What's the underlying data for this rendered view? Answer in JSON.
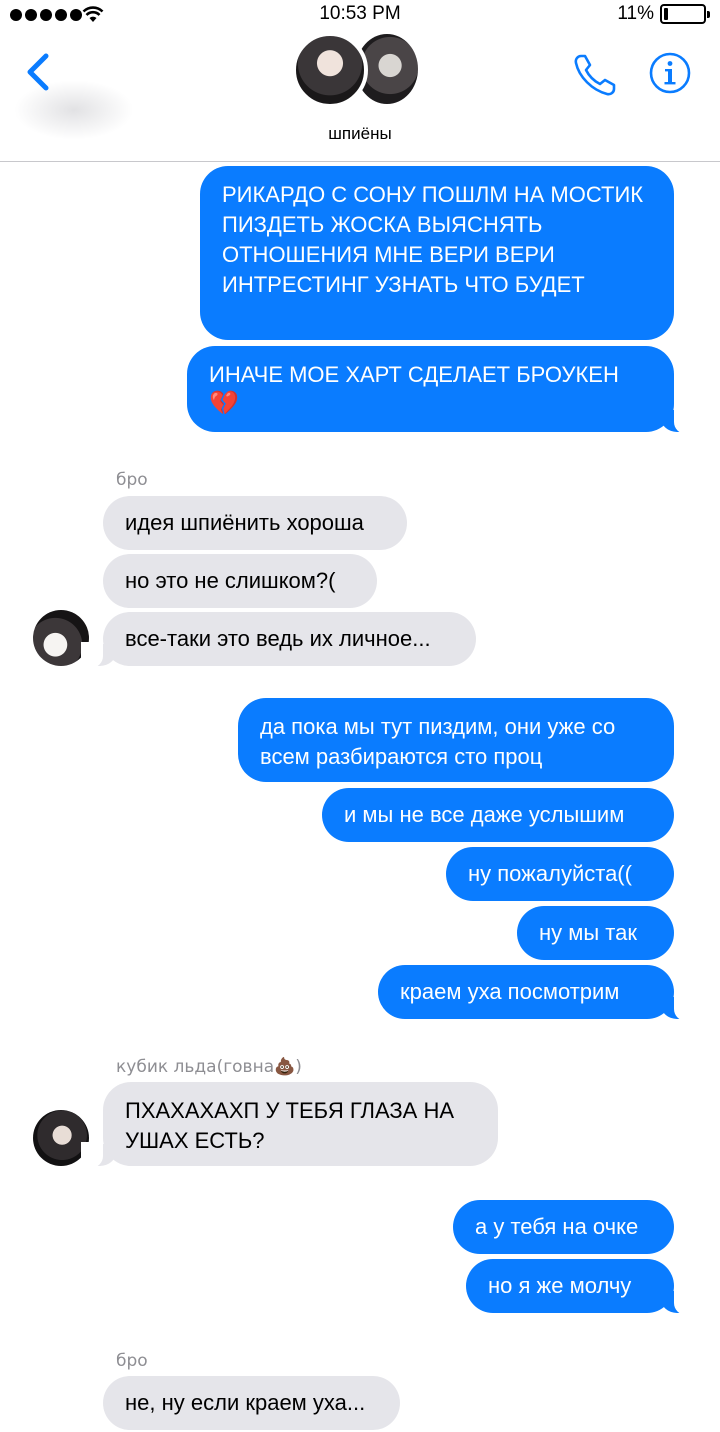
{
  "status_bar": {
    "time": "10:53 PM",
    "battery_pct": "11%",
    "battery_level": 0.11
  },
  "header": {
    "group_name": "шпиёны",
    "back_icon": "chevron-left-icon",
    "call_icon": "phone-icon",
    "info_icon": "info-icon",
    "accent_color": "#0a7cff"
  },
  "messages": [
    {
      "dir": "out",
      "text": "РИКАРДО С СОНУ ПОШЛМ НА МОСТИК ПИЗДЕТЬ ЖОСКА ВЫЯСНЯТЬ ОТНОШЕНИЯ МНЕ ВЕРИ ВЕРИ ИНТРЕСТИНГ УЗНАТЬ ЧТО БУДЕТ"
    },
    {
      "dir": "out",
      "text": "ИНАЧЕ МОЕ ХАРТ СДЕЛАЕТ БРОУКЕН",
      "emoji": "💔"
    },
    {
      "dir": "in",
      "sender": "бро"
    },
    {
      "dir": "in",
      "text": "идея шпиёнить хороша"
    },
    {
      "dir": "in",
      "text": "но это не слишком?("
    },
    {
      "dir": "in",
      "text": "все-таки это ведь их личное..."
    },
    {
      "dir": "out",
      "text": "да пока мы тут пиздим, они уже со всем разбираются сто проц"
    },
    {
      "dir": "out",
      "text": "и мы не все даже услышим"
    },
    {
      "dir": "out",
      "text": "ну пожалуйста(("
    },
    {
      "dir": "out",
      "text": "ну мы так"
    },
    {
      "dir": "out",
      "text": "краем уха посмотрим"
    },
    {
      "dir": "in",
      "sender": "кубик льда(говна💩)"
    },
    {
      "dir": "in",
      "text": "ПХАХАХАХП У ТЕБЯ ГЛАЗА НА УШАХ ЕСТЬ?"
    },
    {
      "dir": "out",
      "text": "а у тебя на очке"
    },
    {
      "dir": "out",
      "text": "но я же молчу"
    },
    {
      "dir": "in",
      "sender": "бро"
    },
    {
      "dir": "in",
      "text": "не, ну если краем уха..."
    }
  ]
}
